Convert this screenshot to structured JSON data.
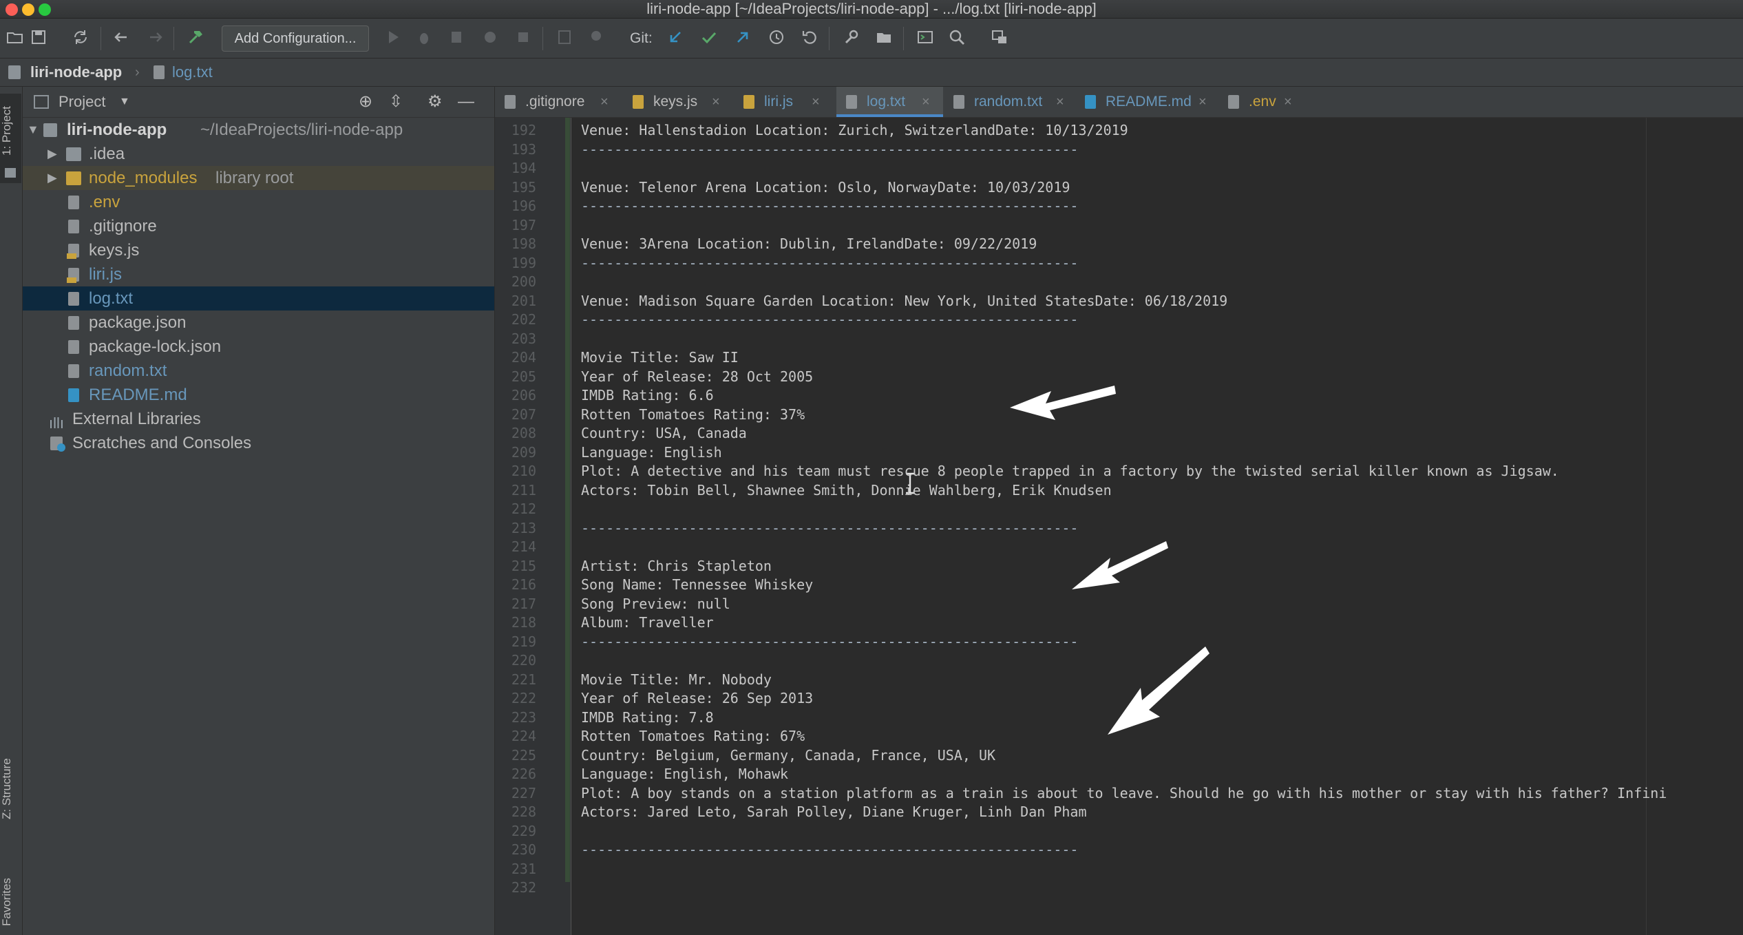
{
  "window": {
    "title": "liri-node-app [~/IdeaProjects/liri-node-app] - .../log.txt [liri-node-app]"
  },
  "toolbar": {
    "add_configuration": "Add Configuration...",
    "git_label": "Git:",
    "icons": [
      "open-folder-icon",
      "save-icon",
      "sync-icon",
      "back-arrow-icon",
      "forward-arrow-icon",
      "build-hammer-icon",
      "run-icon",
      "debug-icon",
      "coverage-icon",
      "profile-icon",
      "stop-icon",
      "attach-icon",
      "run-manager-icon",
      "git-update-icon",
      "git-commit-icon",
      "git-push-icon",
      "history-icon",
      "rollback-icon",
      "settings-wrench-icon",
      "project-structure-icon",
      "terminal-icon",
      "search-icon",
      "presentation-icon"
    ]
  },
  "navbar": {
    "project": "liri-node-app",
    "file": "log.txt"
  },
  "left_stripe": {
    "project_tab": "1: Project",
    "structure_tab": "Z: Structure",
    "favorites_tab": "Favorites"
  },
  "project_panel": {
    "header": "Project",
    "root_name": "liri-node-app",
    "root_path": "~/IdeaProjects/liri-node-app",
    "items": [
      {
        "label": ".idea",
        "note": ""
      },
      {
        "label": "node_modules",
        "note": "library root"
      },
      {
        "label": ".env"
      },
      {
        "label": ".gitignore"
      },
      {
        "label": "keys.js"
      },
      {
        "label": "liri.js"
      },
      {
        "label": "log.txt"
      },
      {
        "label": "package.json"
      },
      {
        "label": "package-lock.json"
      },
      {
        "label": "random.txt"
      },
      {
        "label": "README.md"
      }
    ],
    "external_libraries": "External Libraries",
    "scratches": "Scratches and Consoles"
  },
  "tabs": [
    {
      "label": ".gitignore"
    },
    {
      "label": "keys.js"
    },
    {
      "label": "liri.js"
    },
    {
      "label": "log.txt",
      "active": true
    },
    {
      "label": "random.txt"
    },
    {
      "label": "README.md"
    },
    {
      "label": ".env"
    }
  ],
  "editor": {
    "line_numbers": [
      "192",
      "193",
      "194",
      "195",
      "196",
      "197",
      "198",
      "199",
      "200",
      "201",
      "202",
      "203",
      "204",
      "205",
      "206",
      "207",
      "208",
      "209",
      "210",
      "211",
      "212",
      "213",
      "214",
      "215",
      "216",
      "217",
      "218",
      "219",
      "220",
      "221",
      "222",
      "223",
      "224",
      "225",
      "226",
      "227",
      "228",
      "229",
      "230",
      "231",
      "232"
    ],
    "lines": [
      "Venue: Hallenstadion Location: Zurich, SwitzerlandDate: 10/13/2019",
      "------------------------------------------------------------",
      "",
      "Venue: Telenor Arena Location: Oslo, NorwayDate: 10/03/2019",
      "------------------------------------------------------------",
      "",
      "Venue: 3Arena Location: Dublin, IrelandDate: 09/22/2019",
      "------------------------------------------------------------",
      "",
      "Venue: Madison Square Garden Location: New York, United StatesDate: 06/18/2019",
      "------------------------------------------------------------",
      "",
      "Movie Title: Saw II",
      "Year of Release: 28 Oct 2005",
      "IMDB Rating: 6.6",
      "Rotten Tomatoes Rating: 37%",
      "Country: USA, Canada",
      "Language: English",
      "Plot: A detective and his team must rescue 8 people trapped in a factory by the twisted serial killer known as Jigsaw.",
      "Actors: Tobin Bell, Shawnee Smith, Donnie Wahlberg, Erik Knudsen",
      "",
      "------------------------------------------------------------",
      "",
      "Artist: Chris Stapleton",
      "Song Name: Tennessee Whiskey",
      "Song Preview: null",
      "Album: Traveller",
      "------------------------------------------------------------",
      "",
      "Movie Title: Mr. Nobody",
      "Year of Release: 26 Sep 2013",
      "IMDB Rating: 7.8",
      "Rotten Tomatoes Rating: 67%",
      "Country: Belgium, Germany, Canada, France, USA, UK",
      "Language: English, Mohawk",
      "Plot: A boy stands on a station platform as a train is about to leave. Should he go with his mother or stay with his father? Infini",
      "Actors: Jared Leto, Sarah Polley, Diane Kruger, Linh Dan Pham",
      "",
      "------------------------------------------------------------",
      "",
      ""
    ]
  },
  "colors": {
    "active_tab_underline": "#4a88c7",
    "selection": "#0d293e",
    "node_modules": "#c9a33d",
    "modified_file": "#6897bb"
  }
}
